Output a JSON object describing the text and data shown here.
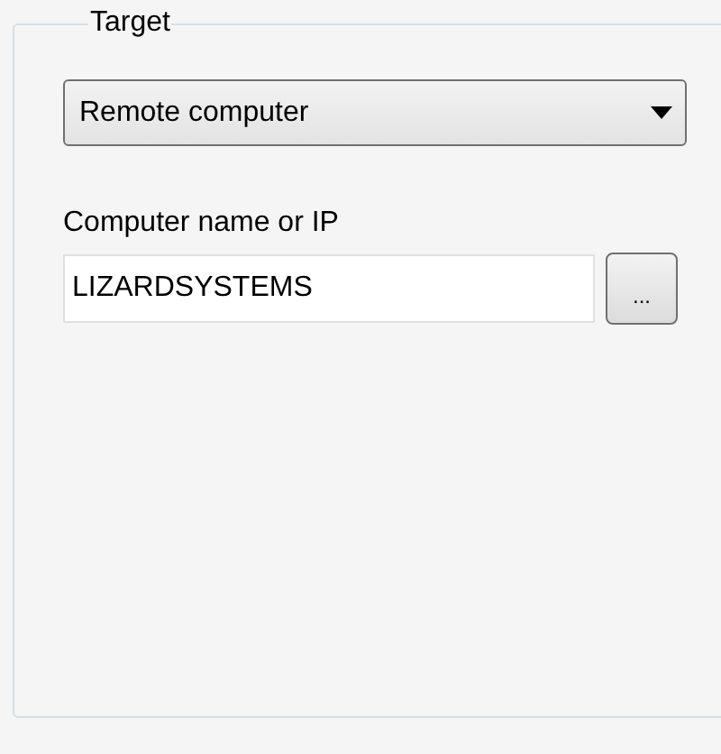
{
  "group": {
    "title": "Target"
  },
  "target_type": {
    "value": "Remote computer"
  },
  "computer_field": {
    "label": "Computer name or IP",
    "value": "LIZARDSYSTEMS"
  },
  "browse_button": {
    "label": "..."
  }
}
